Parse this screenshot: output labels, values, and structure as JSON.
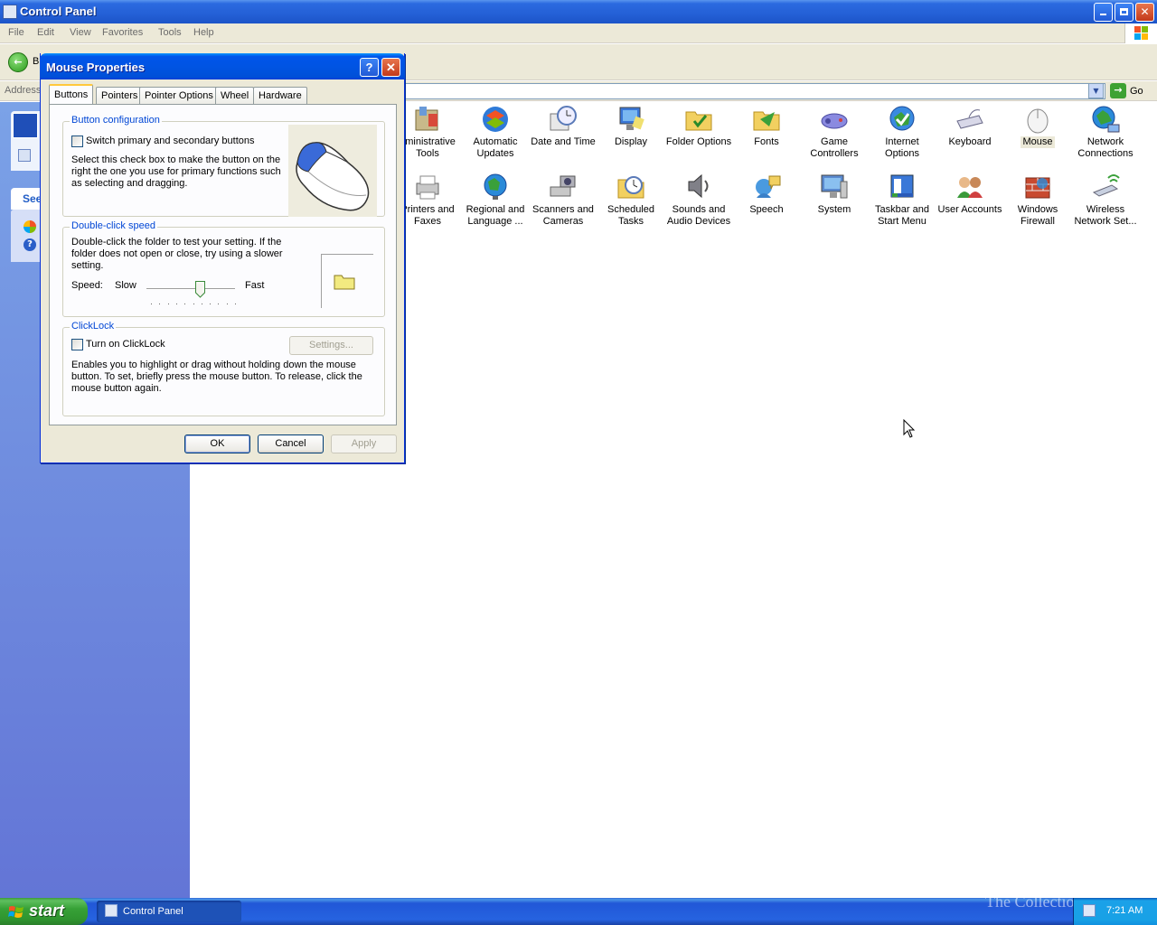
{
  "window": {
    "title": "Control Panel",
    "menu": [
      "File",
      "Edit",
      "View",
      "Favorites",
      "Tools",
      "Help"
    ],
    "back_label": "B",
    "address_label": "Address",
    "go_label": "Go"
  },
  "left_pane": {
    "see_also_heading": "See"
  },
  "control_panel_items": [
    {
      "label": "dministrative Tools",
      "icon": "admin-tools-icon"
    },
    {
      "label": "Automatic Updates",
      "icon": "automatic-updates-icon"
    },
    {
      "label": "Date and Time",
      "icon": "date-time-icon"
    },
    {
      "label": "Display",
      "icon": "display-icon"
    },
    {
      "label": "Folder Options",
      "icon": "folder-options-icon"
    },
    {
      "label": "Fonts",
      "icon": "fonts-icon"
    },
    {
      "label": "Game Controllers",
      "icon": "game-controllers-icon"
    },
    {
      "label": "Internet Options",
      "icon": "internet-options-icon"
    },
    {
      "label": "Keyboard",
      "icon": "keyboard-icon"
    },
    {
      "label": "Mouse",
      "icon": "mouse-icon"
    },
    {
      "label": "Network Connections",
      "icon": "network-connections-icon"
    },
    {
      "label": "Printers and Faxes",
      "icon": "printers-icon"
    },
    {
      "label": "Regional and Language ...",
      "icon": "regional-icon"
    },
    {
      "label": "Scanners and Cameras",
      "icon": "scanners-icon"
    },
    {
      "label": "Scheduled Tasks",
      "icon": "scheduled-tasks-icon"
    },
    {
      "label": "Sounds and Audio Devices",
      "icon": "sounds-icon"
    },
    {
      "label": "Speech",
      "icon": "speech-icon"
    },
    {
      "label": "System",
      "icon": "system-icon"
    },
    {
      "label": "Taskbar and Start Menu",
      "icon": "taskbar-icon"
    },
    {
      "label": "User Accounts",
      "icon": "user-accounts-icon"
    },
    {
      "label": "Windows Firewall",
      "icon": "firewall-icon"
    },
    {
      "label": "Wireless Network Set...",
      "icon": "wireless-icon"
    }
  ],
  "dialog": {
    "title": "Mouse Properties",
    "help_label": "?",
    "close_label": "X",
    "tabs": [
      "Buttons",
      "Pointers",
      "Pointer Options",
      "Wheel",
      "Hardware"
    ],
    "active_tab": "Buttons",
    "button_config": {
      "title": "Button configuration",
      "checkbox_label": "Switch primary and secondary buttons",
      "checked": false,
      "description_lines": [
        "Select this check box to make the button on the",
        "right the one you use for primary functions such",
        "as selecting and dragging."
      ]
    },
    "double_click": {
      "title": "Double-click speed",
      "description_lines": [
        "Double-click the folder to test your setting. If the",
        "folder does not open or close, try using a slower",
        "setting."
      ],
      "speed_label": "Speed:",
      "slow_label": "Slow",
      "fast_label": "Fast",
      "speed_value_fraction": 0.6
    },
    "clicklock": {
      "title": "ClickLock",
      "checkbox_label": "Turn on ClickLock",
      "checked": false,
      "settings_label": "Settings...",
      "description_lines": [
        "Enables you to highlight or drag without holding down the mouse",
        "button. To set, briefly press the mouse button. To release, click the",
        "mouse button again."
      ]
    },
    "ok_label": "OK",
    "cancel_label": "Cancel",
    "apply_label": "Apply"
  },
  "taskbar": {
    "start_label": "start",
    "task_label": "Control Panel",
    "clock": "7:21 AM",
    "watermark": "The Collection Book"
  },
  "colors": {
    "titlebar_blue": "#0054e3",
    "group_title": "#0046d5",
    "start_green": "#37a137"
  }
}
